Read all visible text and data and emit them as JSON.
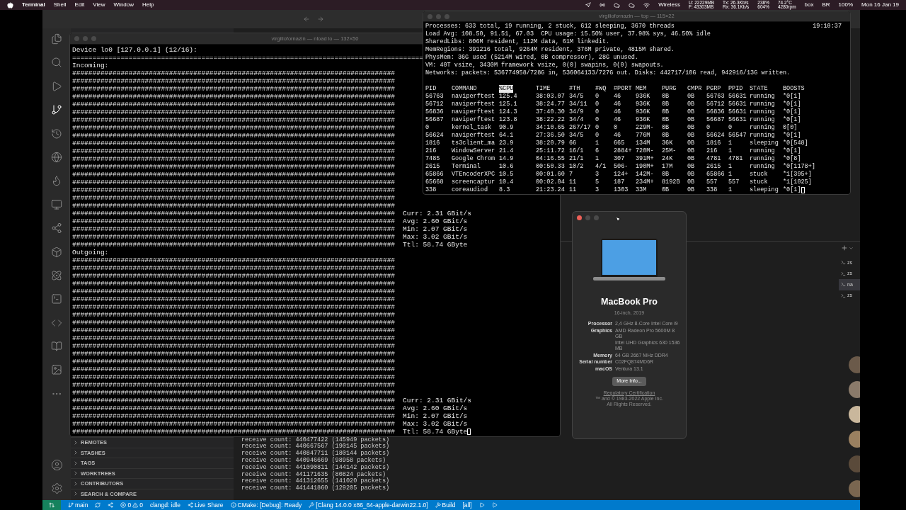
{
  "menubar": {
    "app_name": "Terminal",
    "menus": [
      "Shell",
      "Edit",
      "View",
      "Window",
      "Help"
    ],
    "status_items": [
      {
        "lines": [
          "Wireless"
        ]
      },
      {
        "lines": [
          "U: 22229MB",
          "F: 43303MB"
        ]
      },
      {
        "lines": [
          "Tx: 26.3Kb/s",
          "Rx: 36.1Kb/s"
        ]
      },
      {
        "lines": [
          "238%",
          "604%"
        ]
      },
      {
        "lines": [
          "74.2°C",
          "4280rpm"
        ]
      },
      {
        "lines": [
          "box"
        ]
      },
      {
        "lines": [
          "BR"
        ]
      },
      {
        "lines": [
          "100%"
        ]
      },
      {
        "lines": [
          "Mon 16 Jan 19"
        ]
      }
    ]
  },
  "vscode": {
    "sidebar_sections": [
      "REMOTES",
      "STASHES",
      "TAGS",
      "WORKTREES",
      "CONTRIBUTORS",
      "SEARCH & COMPARE"
    ],
    "terminal_lines": [
      "receive count: 440477422 (145949 packets)",
      "receive count: 440667567 (190145 packets)",
      "receive count: 440847711 (180144 packets)",
      "receive count: 440946669 (98958 packets)",
      "receive count: 441090811 (144142 packets)",
      "receive count: 441171635 (80824 packets)",
      "receive count: 441312655 (141020 packets)",
      "receive count: 441441860 (129205 packets)"
    ],
    "terminal_tabs": [
      {
        "label": "zs",
        "selected": false
      },
      {
        "label": "zs",
        "selected": false
      },
      {
        "label": "na",
        "selected": true
      },
      {
        "label": "zs",
        "selected": false
      }
    ],
    "status_bar": {
      "branch": "main",
      "errors": "0",
      "warnings": "0",
      "clangd": "clangd: idle",
      "live_share": "Live Share",
      "cmake": "CMake: [Debug]: Ready",
      "kit": "[Clang 14.0.0 x86_64-apple-darwin22.1.0]",
      "build": "Build",
      "target": "[all]"
    }
  },
  "nload": {
    "title": "virgiliofornazin — nload lo — 132×50",
    "device": "Device lo0 [127.0.0.1] (12/16):",
    "separator": "=======================================================================================",
    "sections": [
      {
        "label": "Incoming:",
        "rows": [
          "################################################################################",
          "################################################################################",
          "################################################################################",
          "################################################################################",
          "################################################################################",
          "################################################################################",
          "################################################################################",
          "################################################################################",
          "################################################################################",
          "################################################################################",
          "################################################################################",
          "################################################################################",
          "################################################################################",
          "################################################################################",
          "################################################################################",
          "################################################################################",
          "################################################################################",
          "################################################################################",
          "################################################################################",
          "################################################################################",
          "################################################################################",
          "################################################################################",
          "################################################################################"
        ],
        "stats": [
          "Curr: 2.31 GBit/s",
          "Avg: 2.60 GBit/s",
          "Min: 2.07 GBit/s",
          "Max: 3.02 GBit/s",
          "Ttl: 58.74 GByte"
        ]
      },
      {
        "label": "Outgoing:",
        "rows": [
          "################################################################################",
          "################################################################################",
          "################################################################################",
          "################################################################################",
          "################################################################################",
          "################################################################################",
          "################################################################################",
          "################################################################################",
          "################################################################################",
          "################################################################################",
          "################################################################################",
          "################################################################################",
          "################################################################################",
          "################################################################################",
          "################################################################################",
          "################################################################################",
          "################################################################################",
          "################################################################################",
          "################################################################################",
          "################################################################################",
          "################################################################################",
          "################################################################################",
          "################################################################################"
        ],
        "stats": [
          "Curr: 2.31 GBit/s",
          "Avg: 2.60 GBit/s",
          "Min: 2.07 GBit/s",
          "Max: 3.02 GBit/s",
          "Ttl: 58.74 GByte"
        ]
      }
    ]
  },
  "top": {
    "title": "virgiliofornazin — top — 115×22",
    "time": "19:10:37",
    "summary": [
      "Processes: 633 total, 19 running, 2 stuck, 612 sleeping, 3670 threads",
      "Load Avg: 108.50, 91.51, 67.03  CPU usage: 15.50% user, 37.98% sys, 46.50% idle",
      "SharedLibs: 806M resident, 112M data, 61M linkedit.",
      "MemRegions: 391216 total, 9264M resident, 376M private, 4815M shared.",
      "PhysMem: 36G used (5214M wired, 0B compressor), 28G unused.",
      "VM: 40T vsize, 3430M framework vsize, 0(0) swapins, 0(0) swapouts.",
      "Networks: packets: 536774958/728G in, 536064133/727G out. Disks: 442717/10G read, 942916/13G written."
    ],
    "columns": [
      {
        "label": "PID",
        "selected": false
      },
      {
        "label": "COMMAND",
        "selected": false
      },
      {
        "label": "%CPU",
        "selected": true
      },
      {
        "label": "TIME",
        "selected": false
      },
      {
        "label": "#TH",
        "selected": false
      },
      {
        "label": "#WQ",
        "selected": false
      },
      {
        "label": "#PORT",
        "selected": false
      },
      {
        "label": "MEM",
        "selected": false
      },
      {
        "label": "PURG",
        "selected": false
      },
      {
        "label": "CMPR",
        "selected": false
      },
      {
        "label": "PGRP",
        "selected": false
      },
      {
        "label": "PPID",
        "selected": false
      },
      {
        "label": "STATE",
        "selected": false
      },
      {
        "label": "BOOSTS",
        "selected": false
      }
    ],
    "rows": [
      [
        "56763",
        "naviperftest",
        "125.4",
        "38:03.07",
        "34/5",
        "0",
        "46",
        "936K",
        "0B",
        "0B",
        "56763",
        "56631",
        "running",
        "*0[1]"
      ],
      [
        "56712",
        "naviperftest",
        "125.1",
        "38:24.77",
        "34/11",
        "0",
        "46",
        "936K",
        "0B",
        "0B",
        "56712",
        "56631",
        "running",
        "*0[1]"
      ],
      [
        "56836",
        "naviperftest",
        "124.3",
        "37:40.30",
        "34/9",
        "0",
        "46",
        "936K",
        "0B",
        "0B",
        "56836",
        "56631",
        "running",
        "*0[1]"
      ],
      [
        "56687",
        "naviperftest",
        "123.8",
        "38:22.22",
        "34/4",
        "0",
        "46",
        "936K",
        "0B",
        "0B",
        "56687",
        "56631",
        "running",
        "*0[1]"
      ],
      [
        "0",
        "kernel_task",
        "90.9",
        "34:10.65",
        "267/17",
        "0",
        "0",
        "229M-",
        "0B",
        "0B",
        "0",
        "0",
        "running",
        "0[0]"
      ],
      [
        "56624",
        "naviperftest",
        "64.1",
        "27:36.50",
        "34/5",
        "0",
        "46",
        "776M",
        "0B",
        "0B",
        "56624",
        "56547",
        "running",
        "*0[1]"
      ],
      [
        "1816",
        "ts3client_ma",
        "23.9",
        "38:20.79",
        "66",
        "1",
        "665",
        "134M",
        "36K",
        "0B",
        "1816",
        "1",
        "sleeping",
        "*0[548]"
      ],
      [
        "216",
        "WindowServer",
        "21.4",
        "25:11.72",
        "16/1",
        "6",
        "2884+",
        "720M-",
        "25M-",
        "0B",
        "216",
        "1",
        "running",
        "*0[1]"
      ],
      [
        "7485",
        "Google Chrom",
        "14.9",
        "04:16.55",
        "21/1",
        "1",
        "307",
        "391M+",
        "24K",
        "0B",
        "4781",
        "4781",
        "running",
        "*0[8]"
      ],
      [
        "2615",
        "Terminal",
        "10.6",
        "00:50.33",
        "10/2",
        "4/1",
        "506-",
        "190M+",
        "17M",
        "0B",
        "2615",
        "1",
        "running",
        "*0[1178+]"
      ],
      [
        "65866",
        "VTEncoderXPC",
        "10.5",
        "00:01.60",
        "7",
        "3",
        "124+",
        "142M-",
        "0B",
        "0B",
        "65866",
        "1",
        "stuck",
        "*1[395+]"
      ],
      [
        "65668",
        "screencaptur",
        "10.4",
        "00:02.04",
        "11",
        "5",
        "187",
        "234M+",
        "8192B",
        "0B",
        "557",
        "557",
        "stuck",
        "*1[1025]"
      ],
      [
        "338",
        "coreaudiod",
        "8.3",
        "21:23.24",
        "11",
        "3",
        "1303",
        "33M",
        "0B",
        "0B",
        "338",
        "1",
        "sleeping",
        "*0[1]"
      ]
    ]
  },
  "about": {
    "model": "MacBook Pro",
    "subtitle": "16-inch, 2019",
    "specs": [
      {
        "label": "Processor",
        "values": [
          "2,4 GHz 8-Core Intel Core i9"
        ]
      },
      {
        "label": "Graphics",
        "values": [
          "AMD Radeon Pro 5600M 8 GB",
          "Intel UHD Graphics 630 1536 MB"
        ]
      },
      {
        "label": "Memory",
        "values": [
          "64 GB 2667 MHz DDR4"
        ]
      },
      {
        "label": "Serial number",
        "values": [
          "C02FQ874MD6R"
        ]
      },
      {
        "label": "macOS",
        "values": [
          "Ventura 13.1"
        ]
      }
    ],
    "button": "More Info...",
    "link": "Regulatory Certification",
    "copyright": [
      "™ and © 1983-2022 Apple Inc.",
      "All Rights Reserved."
    ]
  }
}
